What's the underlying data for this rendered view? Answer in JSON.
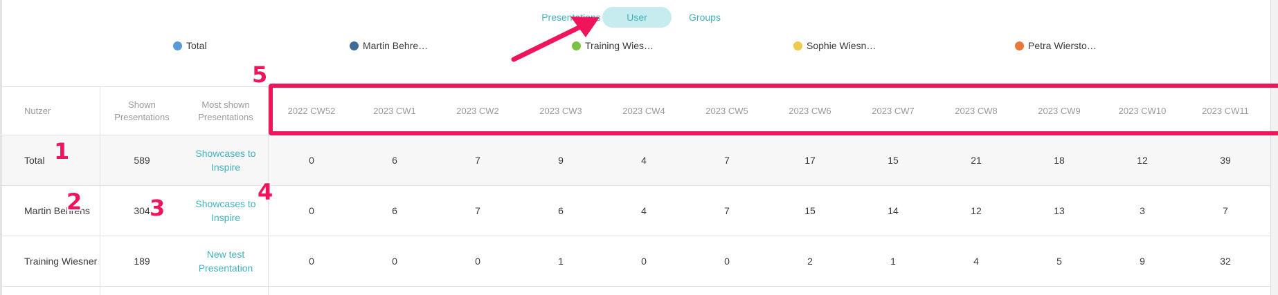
{
  "tabs": [
    {
      "label": "Presentations",
      "active": false
    },
    {
      "label": "User",
      "active": true
    },
    {
      "label": "Groups",
      "active": false
    }
  ],
  "legend": [
    {
      "label": "Total",
      "color": "#5b9bd5"
    },
    {
      "label": "Martin Behre…",
      "color": "#3e6c96"
    },
    {
      "label": "Training Wies…",
      "color": "#7cc242"
    },
    {
      "label": "Sophie Wiesn…",
      "color": "#f0c84a"
    },
    {
      "label": "Petra Wiersto…",
      "color": "#e8793a"
    }
  ],
  "table": {
    "headers": {
      "user": "Nutzer",
      "shown": "Shown Presentations",
      "most": "Most shown Presentations",
      "weeks": [
        "2022 CW52",
        "2023 CW1",
        "2023 CW2",
        "2023 CW3",
        "2023 CW4",
        "2023 CW5",
        "2023 CW6",
        "2023 CW7",
        "2023 CW8",
        "2023 CW9",
        "2023 CW10",
        "2023 CW11"
      ]
    },
    "rows": [
      {
        "user": "Total",
        "shown": "589",
        "most": "Showcases to Inspire",
        "values": [
          "0",
          "6",
          "7",
          "9",
          "4",
          "7",
          "17",
          "15",
          "21",
          "18",
          "12",
          "39"
        ]
      },
      {
        "user": "Martin Behrens",
        "shown": "304",
        "most": "Showcases to Inspire",
        "values": [
          "0",
          "6",
          "7",
          "6",
          "4",
          "7",
          "15",
          "14",
          "12",
          "13",
          "3",
          "7"
        ]
      },
      {
        "user": "Training Wiesner",
        "shown": "189",
        "most": "New test Presentation",
        "values": [
          "0",
          "0",
          "0",
          "1",
          "0",
          "0",
          "2",
          "1",
          "4",
          "5",
          "9",
          "32"
        ]
      }
    ]
  },
  "annotations": {
    "markers": [
      "1",
      "2",
      "3",
      "4",
      "5"
    ],
    "accent_color": "#f0145a"
  }
}
